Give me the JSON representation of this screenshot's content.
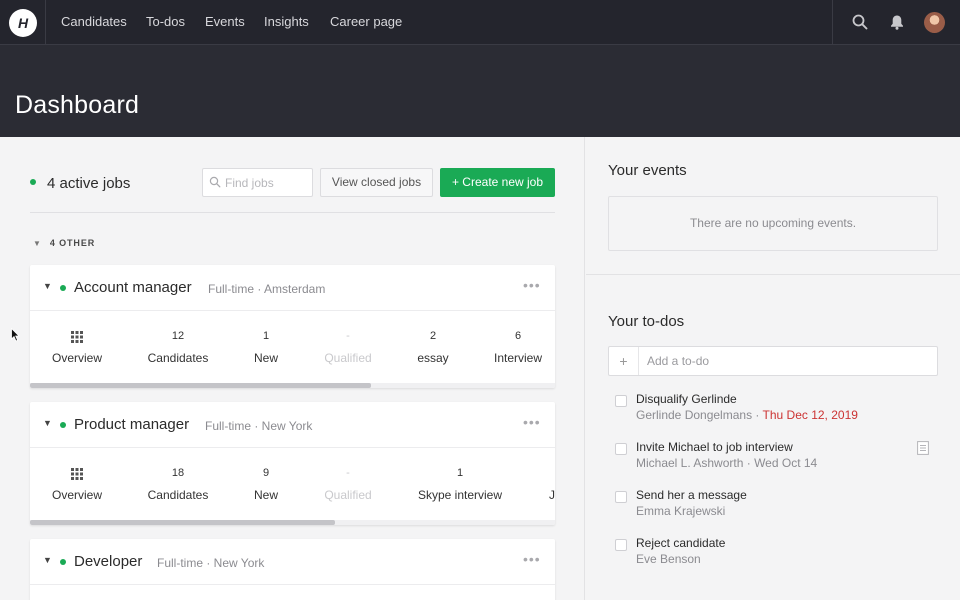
{
  "nav": {
    "logo_letter": "H",
    "items": [
      "Candidates",
      "To-dos",
      "Events",
      "Insights",
      "Career page"
    ],
    "icons": [
      "search-icon",
      "bell-icon",
      "avatar"
    ]
  },
  "header": {
    "title": "Dashboard"
  },
  "jobs": {
    "active_label": "4 active jobs",
    "search_placeholder": "Find jobs",
    "view_closed_label": "View closed jobs",
    "create_label": "+ Create new job",
    "group_label": "4 OTHER",
    "cards": [
      {
        "title": "Account manager",
        "meta": "Full-time · Amsterdam",
        "scroll_fraction": 0.65,
        "stages": [
          {
            "num": "",
            "label": "Overview",
            "icon": "grid-icon"
          },
          {
            "num": "12",
            "label": "Candidates"
          },
          {
            "num": "1",
            "label": "New"
          },
          {
            "num": "-",
            "label": "Qualified",
            "muted": true
          },
          {
            "num": "2",
            "label": "essay"
          },
          {
            "num": "6",
            "label": "Interview"
          }
        ]
      },
      {
        "title": "Product manager",
        "meta": "Full-time · New York",
        "scroll_fraction": 0.58,
        "stages": [
          {
            "num": "",
            "label": "Overview",
            "icon": "grid-icon"
          },
          {
            "num": "18",
            "label": "Candidates"
          },
          {
            "num": "9",
            "label": "New"
          },
          {
            "num": "-",
            "label": "Qualified",
            "muted": true
          },
          {
            "num": "1",
            "label": "Skype interview"
          },
          {
            "num": "",
            "label": "Jo"
          }
        ]
      },
      {
        "title": "Developer",
        "meta": "Full-time · New York"
      }
    ]
  },
  "events": {
    "title": "Your events",
    "empty_text": "There are no upcoming events."
  },
  "todos": {
    "title": "Your to-dos",
    "add_placeholder": "Add a to-do",
    "add_symbol": "+",
    "items": [
      {
        "title": "Disqualify Gerlinde",
        "person": "Gerlinde Dongelmans",
        "sep": " · ",
        "date": "Thu Dec 12, 2019",
        "overdue": true
      },
      {
        "title": "Invite Michael to job interview",
        "person": "Michael L. Ashworth",
        "sep": " · ",
        "date": "Wed Oct 14",
        "overdue": false,
        "has_note": true
      },
      {
        "title": "Send her a message",
        "person": "Emma Krajewski"
      },
      {
        "title": "Reject candidate",
        "person": "Eve Benson"
      }
    ]
  },
  "colors": {
    "nav_bg": "#24252d",
    "hero_bg": "#2b2c34",
    "accent_green": "#1aaa55",
    "overdue_red": "#cc3333"
  }
}
